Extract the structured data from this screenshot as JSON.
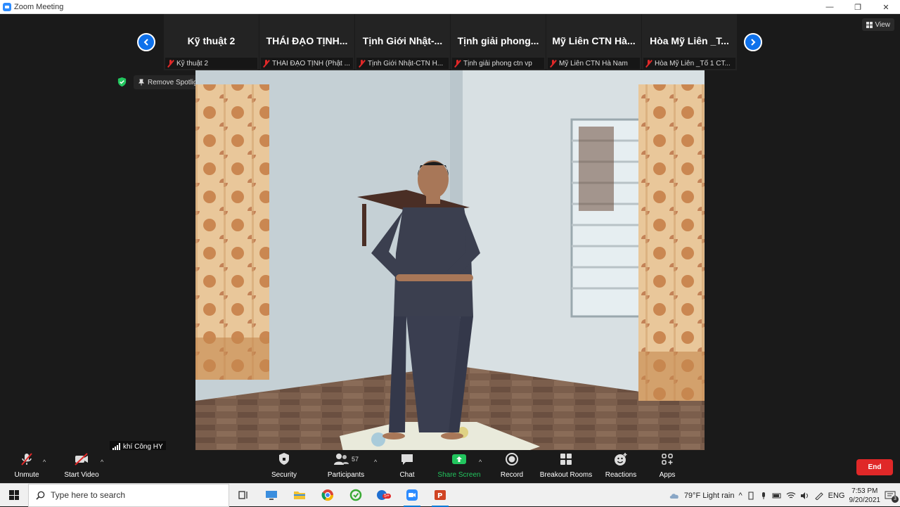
{
  "window": {
    "title": "Zoom Meeting",
    "controls": [
      "—",
      "❐",
      "✕"
    ]
  },
  "header": {
    "view_label": "View"
  },
  "strip": {
    "tiles": [
      {
        "big_name": "Kỹ thuật 2",
        "small_name": "Kỹ thuật 2"
      },
      {
        "big_name": "THÁI ĐẠO TỊNH...",
        "small_name": "THÁI ĐẠO TỊNH (Phật ..."
      },
      {
        "big_name": "Tịnh Giới Nhật-...",
        "small_name": "Tịnh Giới Nhật-CTN H..."
      },
      {
        "big_name": "Tịnh giải phong...",
        "small_name": "Tịnh giải phong ctn vp"
      },
      {
        "big_name": "Mỹ Liên CTN Hà...",
        "small_name": "Mỹ Liên CTN Hà Nam"
      },
      {
        "big_name": "Hòa Mỹ Liên _T...",
        "small_name": "Hòa Mỹ Liên _Tổ 1 CT..."
      }
    ]
  },
  "spotlight": {
    "remove_label": "Remove Spotlight"
  },
  "speaker": {
    "name": "khí Công HY"
  },
  "toolbar": {
    "unmute": "Unmute",
    "start_video": "Start Video",
    "security": "Security",
    "participants": "Participants",
    "participants_count": "57",
    "chat": "Chat",
    "share_screen": "Share Screen",
    "record": "Record",
    "breakout_rooms": "Breakout Rooms",
    "reactions": "Reactions",
    "apps": "Apps",
    "end": "End"
  },
  "taskbar": {
    "search_placeholder": "Type here to search",
    "weather": "79°F  Light rain",
    "lang": "ENG",
    "time": "7:53 PM",
    "date": "9/20/2021",
    "notif_count": "3",
    "badge": "5+"
  },
  "colors": {
    "accent": "#0e71eb",
    "end": "#e02828",
    "share": "#22c55e"
  }
}
